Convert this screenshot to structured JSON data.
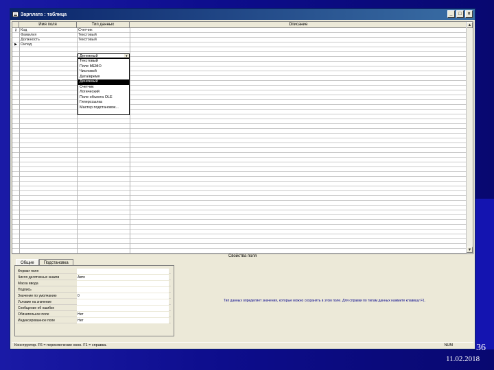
{
  "window": {
    "title": "Зарплата : таблица",
    "btn_min": "_",
    "btn_max": "□",
    "btn_close": "×"
  },
  "grid": {
    "columns": {
      "field": "Имя поля",
      "type": "Тип данных",
      "desc": "Описание"
    },
    "rows": [
      {
        "marker": "⚷",
        "field": "Код",
        "type": "Счетчик"
      },
      {
        "marker": "",
        "field": "Фамилия",
        "type": "Текстовый"
      },
      {
        "marker": "",
        "field": "Должность",
        "type": "Текстовый"
      },
      {
        "marker": "▶",
        "field": "Оклад",
        "type": "Денежный"
      }
    ],
    "dropdown_options": [
      "Текстовый",
      "Поле MEMO",
      "Числовой",
      "Дата/время",
      "Денежный",
      "Счетчик",
      "Логический",
      "Поле объекта OLE",
      "Гиперссылка",
      "Мастер подстановок..."
    ],
    "dropdown_selected_index": 4
  },
  "props": {
    "header": "Свойства поля",
    "tabs": [
      "Общие",
      "Подстановка"
    ],
    "rows": [
      {
        "label": "Формат поля",
        "value": ""
      },
      {
        "label": "Число десятичных знаков",
        "value": "Авто"
      },
      {
        "label": "Маска ввода",
        "value": ""
      },
      {
        "label": "Подпись",
        "value": ""
      },
      {
        "label": "Значение по умолчанию",
        "value": "0"
      },
      {
        "label": "Условие на значение",
        "value": ""
      },
      {
        "label": "Сообщение об ошибке",
        "value": ""
      },
      {
        "label": "Обязательное поле",
        "value": "Нет"
      },
      {
        "label": "Индексированное поле",
        "value": "Нет"
      }
    ],
    "hint": "Тип данных определяет значения, которые можно сохранять в этом поле. Для справки по типам данных нажмите клавишу F1."
  },
  "status": {
    "left": "Конструктор. F6 = переключение окон. F1 = справка.",
    "right": "NUM"
  },
  "slide": {
    "number": "36",
    "date": "11.02.2018"
  }
}
